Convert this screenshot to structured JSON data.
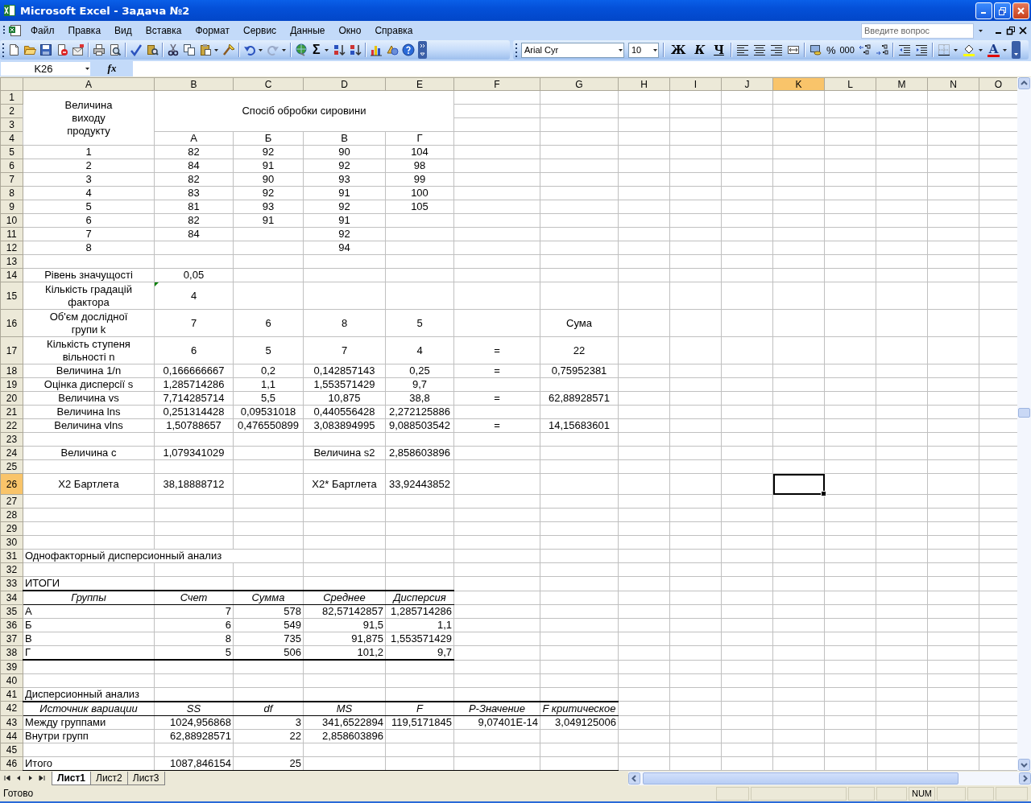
{
  "window": {
    "title": "Microsoft Excel - Задача №2"
  },
  "menu": {
    "items": [
      "Файл",
      "Правка",
      "Вид",
      "Вставка",
      "Формат",
      "Сервис",
      "Данные",
      "Окно",
      "Справка"
    ],
    "help_search": {
      "placeholder": "Введите вопрос"
    }
  },
  "toolbar": {
    "sum": "Σ",
    "font": "Arial Cyr",
    "size": "10",
    "style_buttons": [
      "Ж",
      "К",
      "Ч"
    ],
    "percent": "%",
    "thousands": "000",
    "font_color": "A"
  },
  "formula_bar": {
    "name_box": "K26",
    "function_label": "fx"
  },
  "sheet": {
    "columns": [
      {
        "label": "A",
        "selected": false
      },
      {
        "label": "B",
        "selected": false
      },
      {
        "label": "C",
        "selected": false
      },
      {
        "label": "D",
        "selected": false
      },
      {
        "label": "E",
        "selected": false
      },
      {
        "label": "F",
        "selected": false
      },
      {
        "label": "G",
        "selected": false
      },
      {
        "label": "H",
        "selected": false
      },
      {
        "label": "I",
        "selected": false
      },
      {
        "label": "J",
        "selected": false
      },
      {
        "label": "K",
        "selected": true
      },
      {
        "label": "L",
        "selected": false
      },
      {
        "label": "M",
        "selected": false
      },
      {
        "label": "N",
        "selected": false
      },
      {
        "label": "O",
        "selected": false
      }
    ],
    "rows": [
      {
        "number": "1",
        "selected": false,
        "kind": "input",
        "cells": [
          "Величина\nвиходу\nпродукту",
          "Спосіб обробки сировини"
        ]
      },
      {
        "number": "2",
        "selected": false
      },
      {
        "number": "3",
        "selected": false
      },
      {
        "number": "4",
        "selected": false,
        "kind": "input",
        "cells": [
          null,
          "А",
          "Б",
          "В",
          "Г"
        ]
      },
      {
        "number": "5",
        "selected": false,
        "kind": "input",
        "cells": [
          "1",
          "82",
          "92",
          "90",
          "104"
        ]
      },
      {
        "number": "6",
        "selected": false,
        "kind": "input",
        "cells": [
          "2",
          "84",
          "91",
          "92",
          "98"
        ]
      },
      {
        "number": "7",
        "selected": false,
        "kind": "input",
        "cells": [
          "3",
          "82",
          "90",
          "93",
          "99"
        ]
      },
      {
        "number": "8",
        "selected": false,
        "kind": "input",
        "cells": [
          "4",
          "83",
          "92",
          "91",
          "100"
        ]
      },
      {
        "number": "9",
        "selected": false,
        "kind": "input",
        "cells": [
          "5",
          "81",
          "93",
          "92",
          "105"
        ]
      },
      {
        "number": "10",
        "selected": false,
        "kind": "input",
        "cells": [
          "6",
          "82",
          "91",
          "91"
        ]
      },
      {
        "number": "11",
        "selected": false,
        "kind": "input",
        "cells": [
          "7",
          "84",
          null,
          "92"
        ]
      },
      {
        "number": "12",
        "selected": false,
        "kind": "input",
        "cells": [
          "8",
          null,
          null,
          "94"
        ]
      },
      {
        "number": "13",
        "selected": false
      },
      {
        "number": "14",
        "selected": false,
        "kind": "input",
        "cells": [
          "Рівень значущості",
          "0,05"
        ]
      },
      {
        "number": "15",
        "selected": false,
        "kind": "input",
        "cells": [
          "Кількість градацій\nфактора",
          {
            "text": "4",
            "error_flag": true
          }
        ]
      },
      {
        "number": "16",
        "selected": false,
        "kind": "input",
        "cells": [
          "Об'єм дослідної\nгрупи k",
          "7",
          "6",
          "8",
          "5",
          null,
          "Сума"
        ]
      },
      {
        "number": "17",
        "selected": false,
        "kind": "input",
        "cells": [
          "Кількість ступеня\nвільності n",
          "6",
          "5",
          "7",
          "4",
          "=",
          "22"
        ]
      },
      {
        "number": "18",
        "selected": false,
        "kind": "input",
        "cells": [
          "Величина 1/n",
          "0,166666667",
          "0,2",
          "0,142857143",
          "0,25",
          "=",
          "0,75952381"
        ]
      },
      {
        "number": "19",
        "selected": false,
        "kind": "input",
        "cells": [
          "Оцінка дисперсії s",
          "1,285714286",
          "1,1",
          "1,553571429",
          "9,7"
        ]
      },
      {
        "number": "20",
        "selected": false,
        "kind": "input",
        "cells": [
          "Величина vs",
          "7,714285714",
          "5,5",
          "10,875",
          "38,8",
          "=",
          "62,88928571"
        ]
      },
      {
        "number": "21",
        "selected": false,
        "kind": "input",
        "cells": [
          "Величина lns",
          "0,251314428",
          "0,09531018",
          "0,440556428",
          "2,272125886"
        ]
      },
      {
        "number": "22",
        "selected": false,
        "kind": "input",
        "cells": [
          "Величина vlns",
          "1,50788657",
          "0,476550899",
          "3,083894995",
          "9,088503542",
          "=",
          "14,15683601"
        ]
      },
      {
        "number": "23",
        "selected": false
      },
      {
        "number": "24",
        "selected": false,
        "kind": "input",
        "cells": [
          "Величина с",
          "1,079341029",
          null,
          "Величина s2",
          "2,858603896"
        ]
      },
      {
        "number": "25",
        "selected": false
      },
      {
        "number": "26",
        "selected": true,
        "kind": "input",
        "cells": [
          "X2 Бартлета",
          "38,18888712",
          null,
          "X2* Бартлета",
          "33,92443852"
        ]
      },
      {
        "number": "27",
        "selected": false
      },
      {
        "number": "28",
        "selected": false
      },
      {
        "number": "29",
        "selected": false
      },
      {
        "number": "30",
        "selected": false
      },
      {
        "number": "31",
        "selected": false,
        "kind": "title",
        "cells": [
          "Однофакторный дисперсионный анализ"
        ]
      },
      {
        "number": "32",
        "selected": false
      },
      {
        "number": "33",
        "selected": false,
        "kind": "title",
        "cells": [
          "ИТОГИ"
        ]
      },
      {
        "number": "34",
        "selected": false,
        "kind": "header",
        "cells": [
          "Группы",
          "Счет",
          "Сумма",
          "Среднее",
          "Дисперсия"
        ]
      },
      {
        "number": "35",
        "selected": false,
        "kind": "result",
        "cells": [
          "А",
          "7",
          "578",
          "82,57142857",
          "1,285714286"
        ]
      },
      {
        "number": "36",
        "selected": false,
        "kind": "result",
        "cells": [
          "Б",
          "6",
          "549",
          "91,5",
          "1,1"
        ]
      },
      {
        "number": "37",
        "selected": false,
        "kind": "result",
        "cells": [
          "В",
          "8",
          "735",
          "91,875",
          "1,553571429"
        ]
      },
      {
        "number": "38",
        "selected": false,
        "kind": "result",
        "cells": [
          "Г",
          "5",
          "506",
          "101,2",
          "9,7"
        ]
      },
      {
        "number": "39",
        "selected": false
      },
      {
        "number": "40",
        "selected": false
      },
      {
        "number": "41",
        "selected": false,
        "kind": "title",
        "cells": [
          "Дисперсионный анализ"
        ]
      },
      {
        "number": "42",
        "selected": false,
        "kind": "header",
        "cells": [
          "Источник вариации",
          "SS",
          "df",
          "MS",
          "F",
          "P-Значение",
          "F критическое"
        ]
      },
      {
        "number": "43",
        "selected": false,
        "kind": "result",
        "cells": [
          "Между группами",
          "1024,956868",
          "3",
          "341,6522894",
          "119,5171845",
          "9,07401E-14",
          "3,049125006"
        ]
      },
      {
        "number": "44",
        "selected": false,
        "kind": "result",
        "cells": [
          "Внутри групп",
          "62,88928571",
          "22",
          "2,858603896"
        ]
      },
      {
        "number": "45",
        "selected": false,
        "kind": "result"
      },
      {
        "number": "46",
        "selected": false,
        "kind": "result",
        "cells": [
          "Итого",
          "1087,846154",
          "25"
        ]
      }
    ]
  },
  "sheet_tabs": [
    {
      "label": "Лист1",
      "selected": true
    },
    {
      "label": "Лист2",
      "selected": false
    },
    {
      "label": "Лист3",
      "selected": false
    }
  ],
  "status_bar": {
    "status": "Готово",
    "num_indicator": "NUM"
  }
}
